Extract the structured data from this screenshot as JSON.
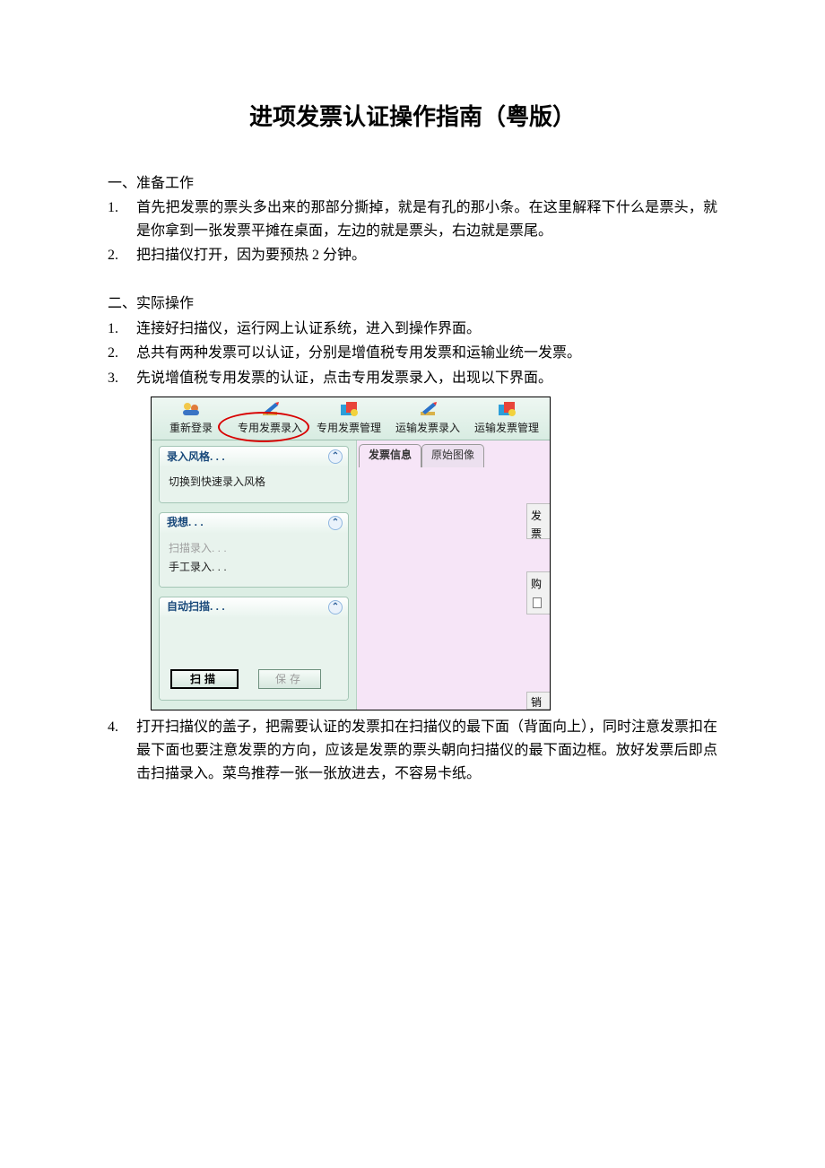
{
  "doc": {
    "title": "进项发票认证操作指南（粤版）",
    "sec1_heading": "一、准备工作",
    "sec1_items": [
      "首先把发票的票头多出来的那部分撕掉，就是有孔的那小条。在这里解释下什么是票头，就是你拿到一张发票平摊在桌面，左边的就是票头，右边就是票尾。",
      "把扫描仪打开，因为要预热 2 分钟。"
    ],
    "sec2_heading": "二、实际操作",
    "sec2_items_top": [
      "连接好扫描仪，运行网上认证系统，进入到操作界面。",
      "总共有两种发票可以认证，分别是增值税专用发票和运输业统一发票。",
      "先说增值税专用发票的认证，点击专用发票录入，出现以下界面。"
    ],
    "sec2_item4": "打开扫描仪的盖子，把需要认证的发票扣在扫描仪的最下面（背面向上），同时注意发票扣在最下面也要注意发票的方向，应该是发票的票头朝向扫描仪的最下面边框。放好发票后即点击扫描录入。菜鸟推荐一张一张放进去，不容易卡纸。"
  },
  "shot": {
    "toolbar": {
      "relogin": "重新登录",
      "special_entry": "专用发票录入",
      "special_manage": "专用发票管理",
      "transport_entry": "运输发票录入",
      "transport_manage": "运输发票管理"
    },
    "panels": {
      "style_title": "录入风格. . .",
      "style_item": "切换到快速录入风格",
      "want_title": "我想. . .",
      "want_scan": "扫描录入. . .",
      "want_manual": "手工录入. . .",
      "auto_title": "自动扫描. . .",
      "btn_scan": "扫描",
      "btn_save": "保存"
    },
    "tabs": {
      "info": "发票信息",
      "image": "原始图像"
    },
    "right_labels": {
      "b1": "发票",
      "b2": "购",
      "b3": "销"
    }
  }
}
